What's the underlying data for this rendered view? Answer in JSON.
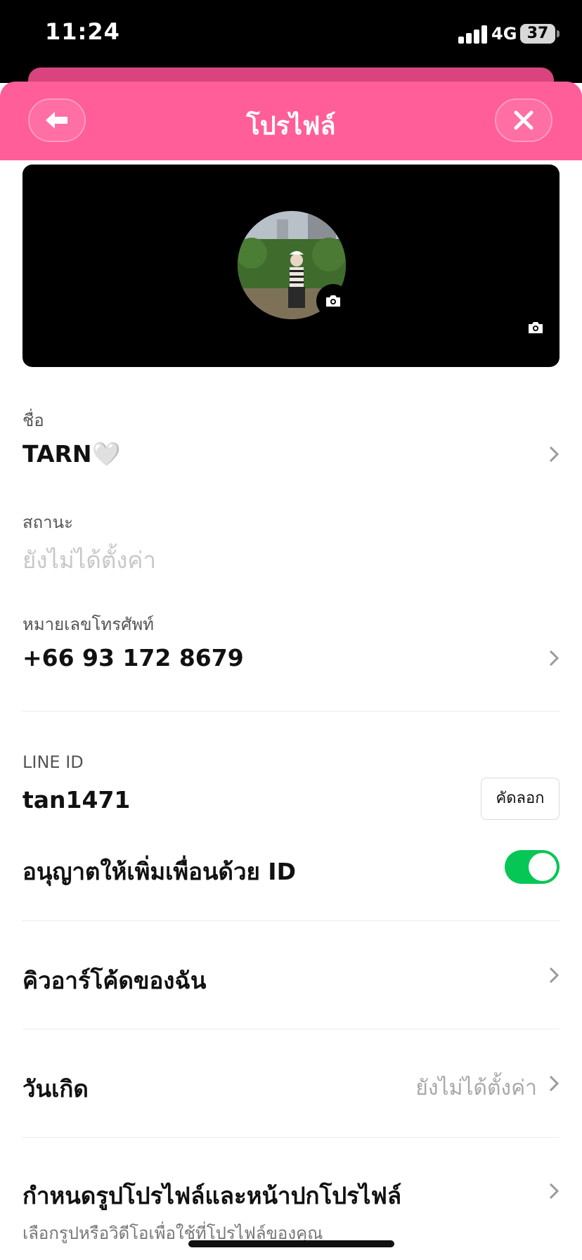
{
  "status_bar": {
    "time": "11:24",
    "network": "4G",
    "battery": "37"
  },
  "header": {
    "title": "โปรไฟล์",
    "back_icon": "arrow-left-icon",
    "close_icon": "close-icon",
    "color": "#ff5e98"
  },
  "profile": {
    "name_label": "ชื่อ",
    "name_value": "TARN🤍",
    "status_label": "สถานะ",
    "status_placeholder": "ยังไม่ได้ตั้งค่า",
    "phone_label": "หมายเลขโทรศัพท์",
    "phone_value": "+66 93 172 8679"
  },
  "line_id": {
    "label": "LINE ID",
    "value": "tan1471",
    "copy_label": "คัดลอก",
    "allow_label": "อนุญาตให้เพิ่มเพื่อนด้วย ID",
    "allow_on": true,
    "toggle_color": "#06c755"
  },
  "menu": {
    "qr_label": "คิวอาร์โค้ดของฉัน",
    "birthday_label": "วันเกิด",
    "birthday_value": "ยังไม่ได้ตั้งค่า",
    "profile_media_label": "กำหนดรูปโปรไฟล์และหน้าปกโปรไฟล์",
    "profile_media_sub": "เลือกรูปหรือวิดีโอเพื่อใช้ที่โปรไฟล์ของคุณ"
  }
}
